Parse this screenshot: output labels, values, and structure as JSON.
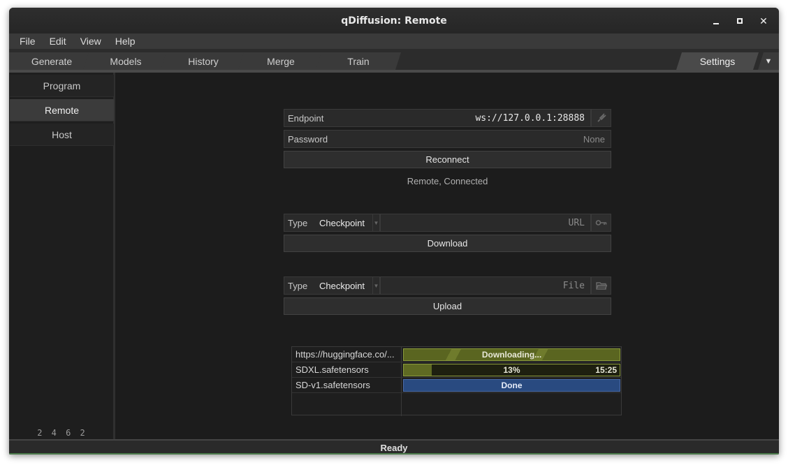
{
  "window": {
    "title": "qDiffusion: Remote",
    "controls": {
      "minimize": "_",
      "maximize": "□",
      "close": "✕"
    }
  },
  "menubar": [
    "File",
    "Edit",
    "View",
    "Help"
  ],
  "tabs": [
    {
      "label": "Generate"
    },
    {
      "label": "Models"
    },
    {
      "label": "History"
    },
    {
      "label": "Merge"
    },
    {
      "label": "Train"
    }
  ],
  "active_tab": {
    "label": "Settings"
  },
  "tab_dropdown": "▼",
  "sidebar": {
    "items": [
      {
        "label": "Program",
        "active": false
      },
      {
        "label": "Remote",
        "active": true
      },
      {
        "label": "Host",
        "active": false
      }
    ],
    "counter": "2 4 6 2"
  },
  "remote": {
    "endpoint_label": "Endpoint",
    "endpoint_value": "ws://127.0.0.1:28888",
    "password_label": "Password",
    "password_placeholder": "None",
    "reconnect_label": "Reconnect",
    "status": "Remote, Connected"
  },
  "download": {
    "type_label": "Type",
    "type_value": "Checkpoint",
    "url_placeholder": "URL",
    "button_label": "Download"
  },
  "upload": {
    "type_label": "Type",
    "type_value": "Checkpoint",
    "file_placeholder": "File",
    "button_label": "Upload"
  },
  "queue": [
    {
      "name": "https://huggingface.co/...",
      "status": "Downloading...",
      "progress": null,
      "time": ""
    },
    {
      "name": "SDXL.safetensors",
      "status": "13%",
      "progress": 0.13,
      "time": "15:25"
    },
    {
      "name": "SD-v1.safetensors",
      "status": "Done",
      "progress": 1.0,
      "time": ""
    }
  ],
  "statusbar": {
    "text": "Ready"
  },
  "colors": {
    "progress_green": "#5f6a23",
    "progress_border": "#8a9a3a",
    "done_blue": "#294a80"
  }
}
